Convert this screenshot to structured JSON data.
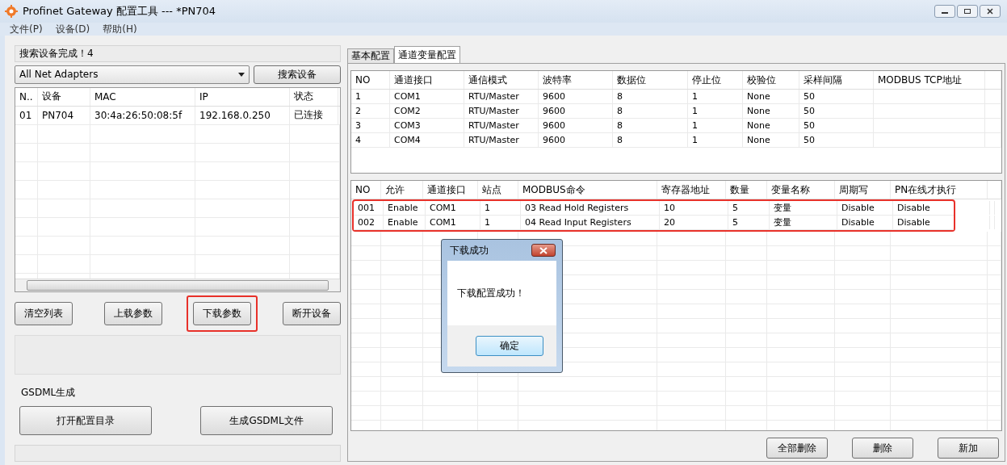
{
  "window": {
    "title": "Profinet Gateway 配置工具 --- *PN704"
  },
  "menu": [
    "文件(P)",
    "设备(D)",
    "帮助(H)"
  ],
  "left": {
    "status": "搜索设备完成！4",
    "adapter": {
      "value": "All Net Adapters"
    },
    "search_button": "搜索设备",
    "devices": {
      "columns": [
        "N..",
        "设备",
        "MAC",
        "IP",
        "状态"
      ],
      "rows": [
        [
          "01",
          "PN704",
          "30:4a:26:50:08:5f",
          "192.168.0.250",
          "已连接"
        ]
      ]
    },
    "buttons": [
      {
        "label": "清空列表",
        "highlighted": false
      },
      {
        "label": "上载参数",
        "highlighted": false
      },
      {
        "label": "下载参数",
        "highlighted": true
      },
      {
        "label": "断开设备",
        "highlighted": false
      }
    ],
    "gsdml": {
      "title": "GSDML生成",
      "buttons": [
        "打开配置目录",
        "生成GSDML文件"
      ]
    }
  },
  "tabs": [
    {
      "label": "基本配置",
      "selected": false
    },
    {
      "label": "通道变量配置",
      "selected": true
    }
  ],
  "channels": {
    "columns": [
      "NO",
      "通道接口",
      "通信模式",
      "波特率",
      "数据位",
      "停止位",
      "校验位",
      "采样间隔",
      "MODBUS TCP地址"
    ],
    "rows": [
      [
        "1",
        "COM1",
        "RTU/Master",
        "9600",
        "8",
        "1",
        "None",
        "50"
      ],
      [
        "2",
        "COM2",
        "RTU/Master",
        "9600",
        "8",
        "1",
        "None",
        "50"
      ],
      [
        "3",
        "COM3",
        "RTU/Master",
        "9600",
        "8",
        "1",
        "None",
        "50"
      ],
      [
        "4",
        "COM4",
        "RTU/Master",
        "9600",
        "8",
        "1",
        "None",
        "50"
      ]
    ]
  },
  "commands": {
    "columns": [
      "NO",
      "允许",
      "通道接口",
      "站点",
      "MODBUS命令",
      "寄存器地址",
      "数量",
      "变量名称",
      "周期写",
      "PN在线才执行"
    ],
    "highlighted": true,
    "rows": [
      [
        "001",
        "Enable",
        "COM1",
        "1",
        "03 Read Hold Registers",
        "10",
        "5",
        "变量",
        "Disable",
        "Disable"
      ],
      [
        "002",
        "Enable",
        "COM1",
        "1",
        "04 Read Input Registers",
        "20",
        "5",
        "变量",
        "Disable",
        "Disable"
      ]
    ]
  },
  "bottom_buttons": [
    "全部删除",
    "删除",
    "新加"
  ],
  "dialog": {
    "title": "下载成功",
    "message": "下载配置成功！",
    "ok": "确定"
  }
}
